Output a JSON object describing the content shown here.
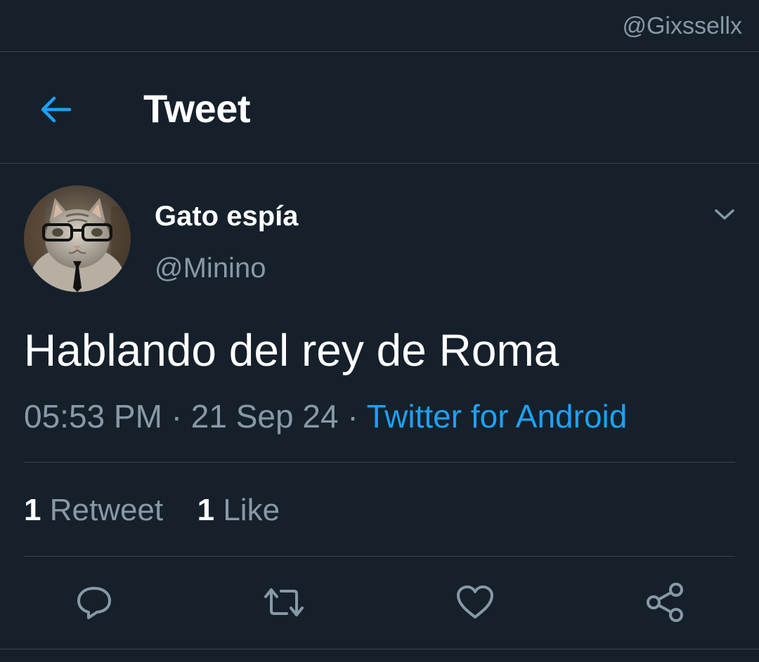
{
  "watermark": "@Gixssellx",
  "header": {
    "title": "Tweet",
    "back_icon": "arrow-left-icon"
  },
  "tweet": {
    "author": {
      "display_name": "Gato espía",
      "handle": "@Minino",
      "avatar": "cat-with-glasses-and-tie"
    },
    "text": "Hablando del rey de Roma",
    "time": "05:53 PM",
    "separator": "·",
    "date": "21 Sep 24",
    "source": "Twitter for Android",
    "stats": {
      "retweets_count": "1",
      "retweets_label": "Retweet",
      "likes_count": "1",
      "likes_label": "Like"
    },
    "actions": [
      "reply-icon",
      "retweet-icon",
      "like-icon",
      "share-icon"
    ]
  },
  "colors": {
    "background": "#15202b",
    "accent": "#1da1f2",
    "secondary_text": "#8899a6",
    "divider": "#38444d",
    "primary_text": "#ffffff"
  }
}
